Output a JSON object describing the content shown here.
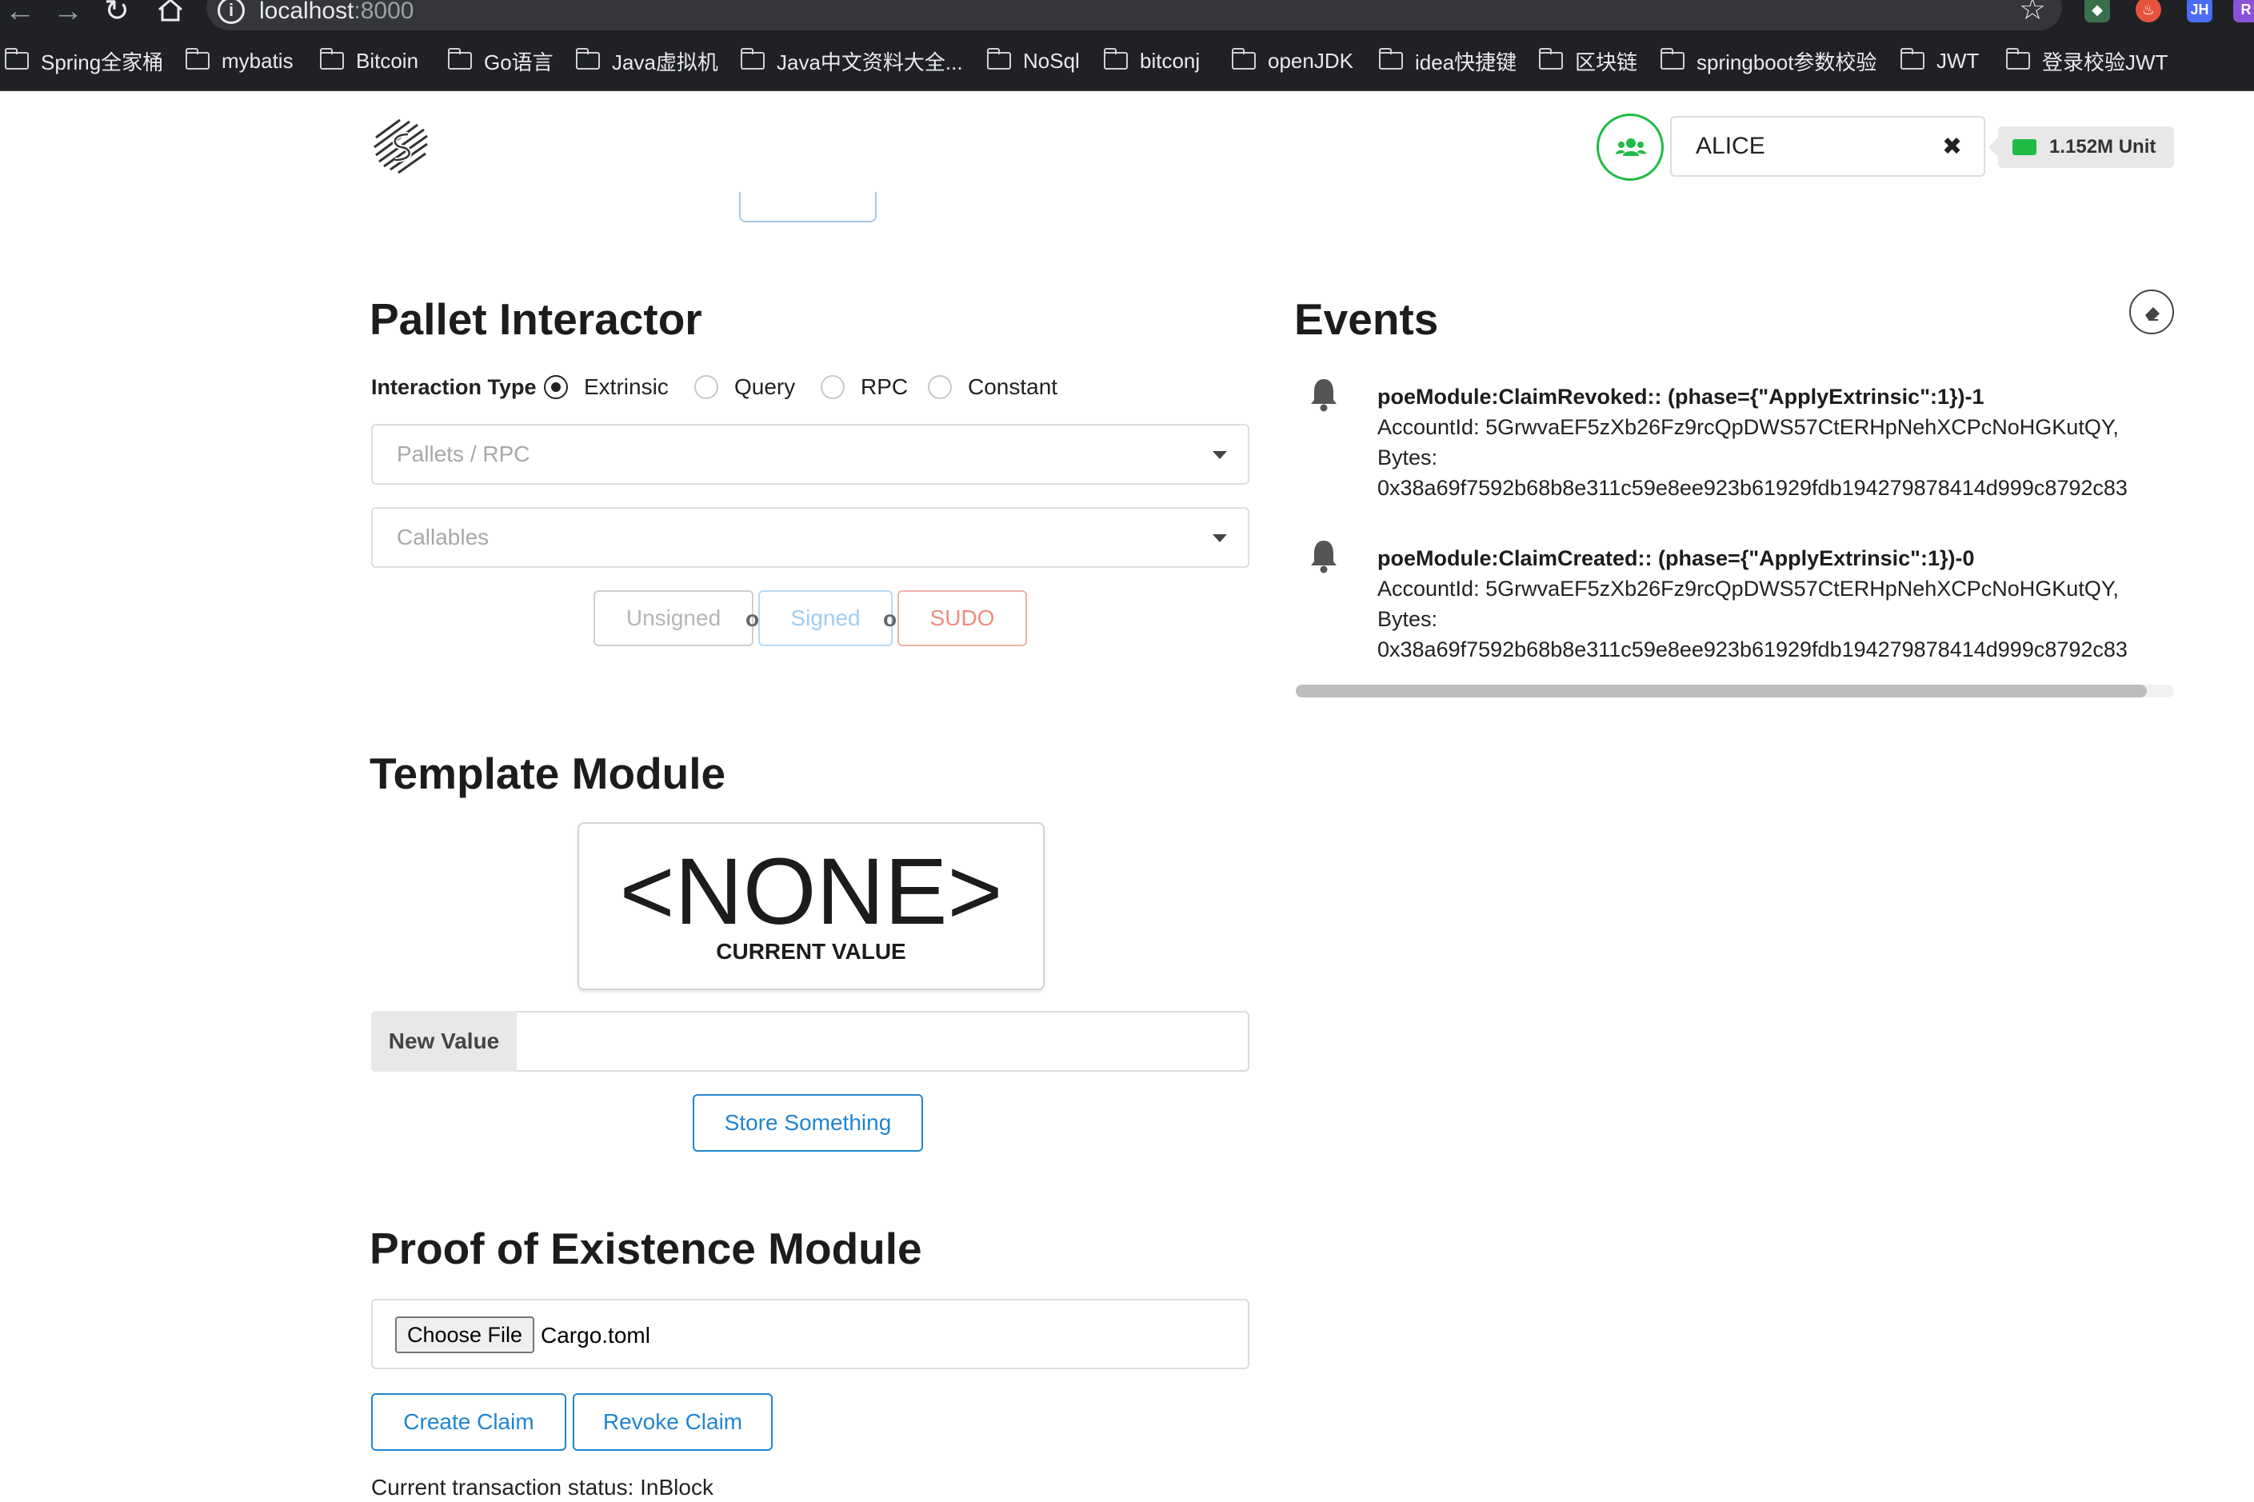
{
  "browser": {
    "url_host": "localhost",
    "url_port": ":8000",
    "extensions": [
      "JH",
      "R"
    ],
    "bookmarks": [
      "Spring全家桶",
      "mybatis",
      "Bitcoin",
      "Go语言",
      "Java虚拟机",
      "Java中文资料大全...",
      "NoSql",
      "bitconj",
      "openJDK",
      "idea快捷键",
      "区块链",
      "springboot参数校验",
      "JWT",
      "登录校验JWT"
    ]
  },
  "header": {
    "account_name": "ALICE",
    "clear_icon": "✖",
    "balance": "1.152M Unit"
  },
  "pallet_interactor": {
    "title": "Pallet Interactor",
    "interaction_type_label": "Interaction Type",
    "radio_options": [
      "Extrinsic",
      "Query",
      "RPC",
      "Constant"
    ],
    "selected": "Extrinsic",
    "pallets_placeholder": "Pallets / RPC",
    "callables_placeholder": "Callables",
    "buttons": {
      "unsigned": "Unsigned",
      "signed": "Signed",
      "sudo": "SUDO",
      "or": "or"
    }
  },
  "template_module": {
    "title": "Template Module",
    "current_value": "<NONE>",
    "current_value_label": "CURRENT VALUE",
    "new_value_label": "New Value",
    "store_button": "Store Something"
  },
  "poe_module": {
    "title": "Proof of Existence Module",
    "choose_file_label": "Choose File",
    "file_name": "Cargo.toml",
    "create_button": "Create Claim",
    "revoke_button": "Revoke Claim",
    "status": "Current transaction status: InBlock"
  },
  "events": {
    "title": "Events",
    "items": [
      {
        "title": "poeModule:ClaimRevoked:: (phase={\"ApplyExtrinsic\":1})-1",
        "account": "AccountId: 5GrwvaEF5zXb26Fz9rcQpDWS57CtERHpNehXCPcNoHGKutQY,",
        "bytes_label": "Bytes:",
        "bytes": "0x38a69f7592b68b8e311c59e8ee923b61929fdb194279878414d999c8792c83"
      },
      {
        "title": "poeModule:ClaimCreated:: (phase={\"ApplyExtrinsic\":1})-0",
        "account": "AccountId: 5GrwvaEF5zXb26Fz9rcQpDWS57CtERHpNehXCPcNoHGKutQY,",
        "bytes_label": "Bytes:",
        "bytes": "0x38a69f7592b68b8e311c59e8ee923b61929fdb194279878414d999c8792c83"
      }
    ]
  },
  "colors": {
    "accent_blue": "#2185d0",
    "green": "#21ba45",
    "sudo_red": "#db2828",
    "signed_blue": "#54c8ff"
  }
}
